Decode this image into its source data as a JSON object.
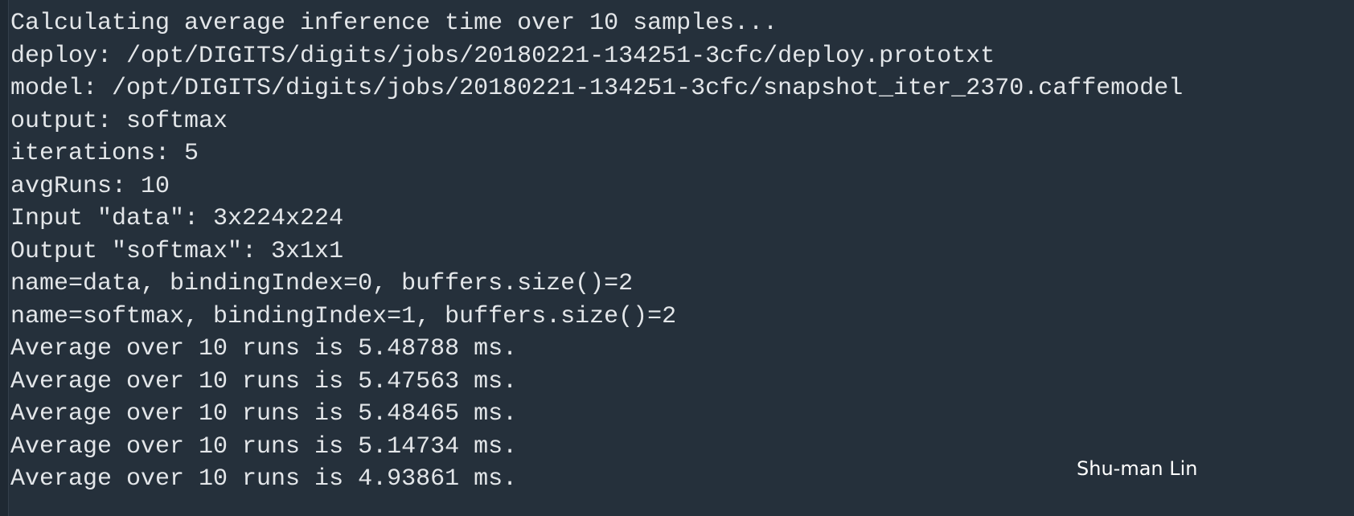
{
  "terminal": {
    "lines": [
      "Calculating average inference time over 10 samples...",
      "deploy: /opt/DIGITS/digits/jobs/20180221-134251-3cfc/deploy.prototxt",
      "model: /opt/DIGITS/digits/jobs/20180221-134251-3cfc/snapshot_iter_2370.caffemodel",
      "output: softmax",
      "iterations: 5",
      "avgRuns: 10",
      "Input \"data\": 3x224x224",
      "Output \"softmax\": 3x1x1",
      "name=data, bindingIndex=0, buffers.size()=2",
      "name=softmax, bindingIndex=1, buffers.size()=2",
      "Average over 10 runs is 5.48788 ms.",
      "Average over 10 runs is 5.47563 ms.",
      "Average over 10 runs is 5.48465 ms.",
      "Average over 10 runs is 5.14734 ms.",
      "Average over 10 runs is 4.93861 ms."
    ]
  },
  "watermark": {
    "text": "Shu-man Lin"
  },
  "colors": {
    "background": "#25303b",
    "text": "#e3e6e9"
  }
}
